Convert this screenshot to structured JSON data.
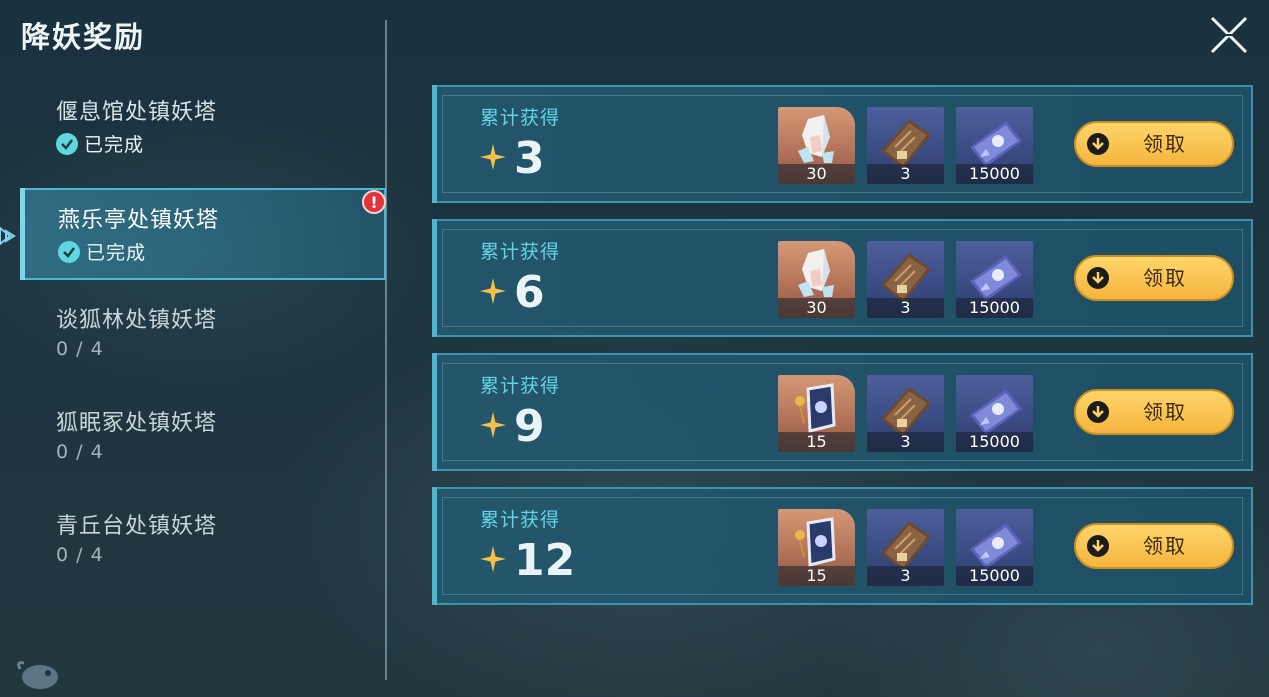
{
  "header": {
    "title": "降妖奖励"
  },
  "towers": [
    {
      "name": "偃息馆处镇妖塔",
      "status": "已完成",
      "completed": true,
      "selected": false,
      "alert": false
    },
    {
      "name": "燕乐亭处镇妖塔",
      "status": "已完成",
      "completed": true,
      "selected": true,
      "alert": true
    },
    {
      "name": "谈狐林处镇妖塔",
      "status": "0 / 4",
      "completed": false,
      "selected": false,
      "alert": false
    },
    {
      "name": "狐眠冢处镇妖塔",
      "status": "0 / 4",
      "completed": false,
      "selected": false,
      "alert": false
    },
    {
      "name": "青丘台处镇妖塔",
      "status": "0 / 4",
      "completed": false,
      "selected": false,
      "alert": false
    }
  ],
  "rewards": [
    {
      "label": "累计获得",
      "count": "3",
      "items": [
        {
          "icon": "crystal-icon",
          "qty": "30"
        },
        {
          "icon": "book-icon",
          "qty": "3"
        },
        {
          "icon": "ticket-icon",
          "qty": "15000"
        }
      ],
      "button": "领取"
    },
    {
      "label": "累计获得",
      "count": "6",
      "items": [
        {
          "icon": "crystal-icon",
          "qty": "30"
        },
        {
          "icon": "book-icon",
          "qty": "3"
        },
        {
          "icon": "ticket-icon",
          "qty": "15000"
        }
      ],
      "button": "领取"
    },
    {
      "label": "累计获得",
      "count": "9",
      "items": [
        {
          "icon": "tome-icon",
          "qty": "15"
        },
        {
          "icon": "book-icon",
          "qty": "3"
        },
        {
          "icon": "ticket-icon",
          "qty": "15000"
        }
      ],
      "button": "领取"
    },
    {
      "label": "累计获得",
      "count": "12",
      "items": [
        {
          "icon": "tome-icon",
          "qty": "15"
        },
        {
          "icon": "book-icon",
          "qty": "3"
        },
        {
          "icon": "ticket-icon",
          "qty": "15000"
        }
      ],
      "button": "领取"
    }
  ],
  "colors": {
    "accent": "#62d4e6",
    "button": "#f4b53e",
    "alert": "#e0353a"
  }
}
